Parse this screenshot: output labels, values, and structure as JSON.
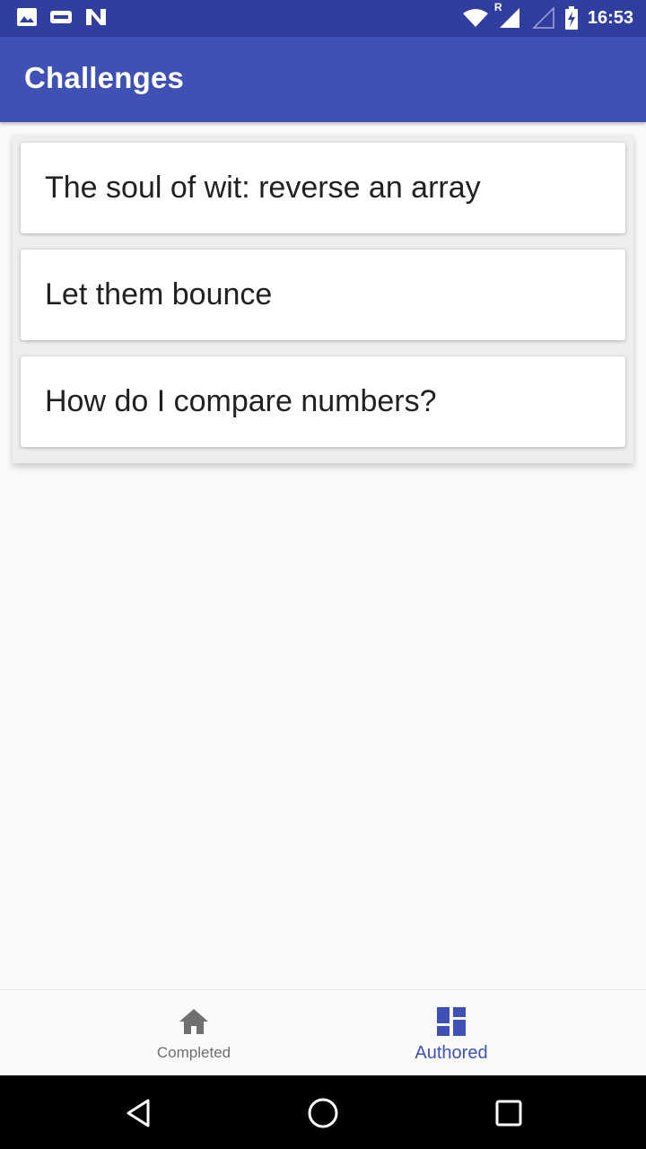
{
  "status_bar": {
    "time": "16:53",
    "roaming_indicator": "R",
    "icons_left": [
      "image-icon",
      "idea-app-icon",
      "n-logo-icon"
    ],
    "icons_right": [
      "wifi-icon",
      "signal-roaming-icon",
      "signal-empty-icon",
      "battery-charging-icon"
    ]
  },
  "app_bar": {
    "title": "Challenges"
  },
  "challenges": [
    {
      "title": "The soul of wit: reverse an array"
    },
    {
      "title": "Let them bounce"
    },
    {
      "title": "How do I compare numbers?"
    }
  ],
  "bottom_nav": {
    "items": [
      {
        "label": "Completed",
        "icon": "home-icon",
        "active": false
      },
      {
        "label": "Authored",
        "icon": "dashboard-icon",
        "active": true
      }
    ]
  },
  "colors": {
    "primary": "#3f51b5",
    "primary_dark": "#303f9f",
    "background": "#fafafa",
    "inactive_nav": "#6f6f6f"
  },
  "system_nav": [
    "back-icon",
    "home-circle-icon",
    "recents-icon"
  ]
}
